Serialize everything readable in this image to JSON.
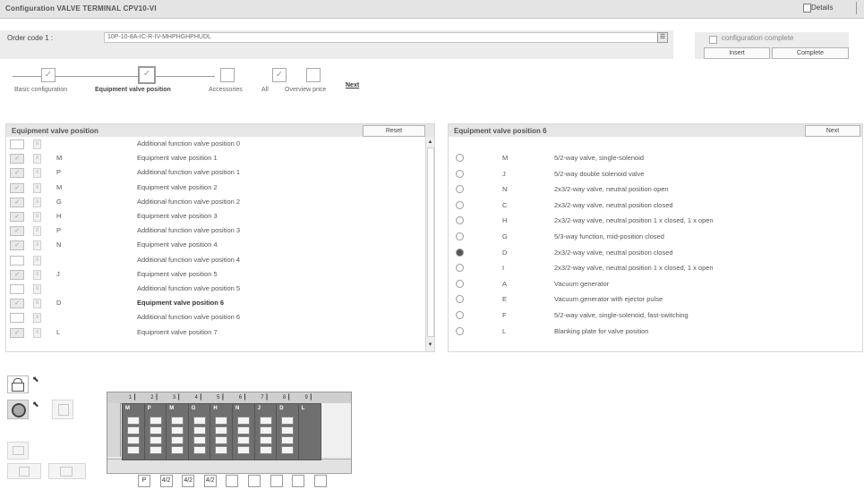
{
  "header": {
    "title": "Configuration VALVE TERMINAL CPV10-VI",
    "details_label": "Details"
  },
  "order": {
    "label": "Order code 1 :",
    "value": "10P-10-8A-IC-R-IV-MHPHGHPHUDL",
    "complete_label": "configuration complete",
    "insert_label": "Insert",
    "complete_button": "Complete"
  },
  "steps": {
    "items": [
      {
        "label": "Basic configuration",
        "active": false,
        "checked": true
      },
      {
        "label": "Equipment valve position",
        "active": true,
        "checked": true
      },
      {
        "label": "Accessories",
        "active": false,
        "checked": false
      },
      {
        "label": "All",
        "active": false,
        "checked": true
      },
      {
        "label": "Overview price",
        "active": false,
        "checked": false
      }
    ],
    "next_label": "Next"
  },
  "left_panel": {
    "title": "Equipment valve position",
    "button": "Reset",
    "rows": [
      {
        "check": false,
        "code": "",
        "desc": "Additional function valve position 0",
        "bold": false
      },
      {
        "check": true,
        "code": "M",
        "desc": "Equipment valve position 1",
        "bold": false
      },
      {
        "check": true,
        "code": "P",
        "desc": "Additional function valve position 1",
        "bold": false
      },
      {
        "check": true,
        "code": "M",
        "desc": "Equipment valve position 2",
        "bold": false
      },
      {
        "check": true,
        "code": "G",
        "desc": "Additional function valve position 2",
        "bold": false
      },
      {
        "check": true,
        "code": "H",
        "desc": "Equipment valve position 3",
        "bold": false
      },
      {
        "check": true,
        "code": "P",
        "desc": "Additional function valve position 3",
        "bold": false
      },
      {
        "check": true,
        "code": "N",
        "desc": "Equipment valve position 4",
        "bold": false
      },
      {
        "check": false,
        "code": "",
        "desc": "Additional function valve position 4",
        "bold": false
      },
      {
        "check": true,
        "code": "J",
        "desc": "Equipment valve position 5",
        "bold": false
      },
      {
        "check": false,
        "code": "",
        "desc": "Additional function valve position 5",
        "bold": false
      },
      {
        "check": true,
        "code": "D",
        "desc": "Equipment valve position 6",
        "bold": true
      },
      {
        "check": false,
        "code": "",
        "desc": "Additional function valve position 6",
        "bold": false
      },
      {
        "check": true,
        "code": "L",
        "desc": "Equipment valve position 7",
        "bold": false
      }
    ]
  },
  "right_panel": {
    "title": "Equipment valve position 6",
    "button": "Next",
    "rows": [
      {
        "selected": false,
        "code": "M",
        "desc": "5/2-way valve, single-solenoid"
      },
      {
        "selected": false,
        "code": "J",
        "desc": "5/2-way double solenoid valve"
      },
      {
        "selected": false,
        "code": "N",
        "desc": "2x3/2-way valve, neutral position open"
      },
      {
        "selected": false,
        "code": "C",
        "desc": "2x3/2-way valve, neutral position closed"
      },
      {
        "selected": false,
        "code": "H",
        "desc": "2x3/2-way valve, neutral position 1 x closed, 1 x open"
      },
      {
        "selected": false,
        "code": "G",
        "desc": "5/3-way function, mid-position closed"
      },
      {
        "selected": true,
        "code": "D",
        "desc": "2x3/2-way valve, neutral position closed"
      },
      {
        "selected": false,
        "code": "I",
        "desc": "2x3/2-way valve, neutral position 1 x closed, 1 x open"
      },
      {
        "selected": false,
        "code": "A",
        "desc": "Vacuum generator"
      },
      {
        "selected": false,
        "code": "E",
        "desc": "Vacuum generator with ejector pulse"
      },
      {
        "selected": false,
        "code": "F",
        "desc": "5/2-way valve, single-solenoid, fast-switching"
      },
      {
        "selected": false,
        "code": "L",
        "desc": "Blanking plate for valve position"
      }
    ]
  },
  "terminal": {
    "slots": [
      "M",
      "P",
      "M",
      "G",
      "H",
      "N",
      "J",
      "D",
      "L"
    ],
    "bottom_labels": [
      "P",
      "4/2",
      "4/2",
      "4/2"
    ]
  }
}
